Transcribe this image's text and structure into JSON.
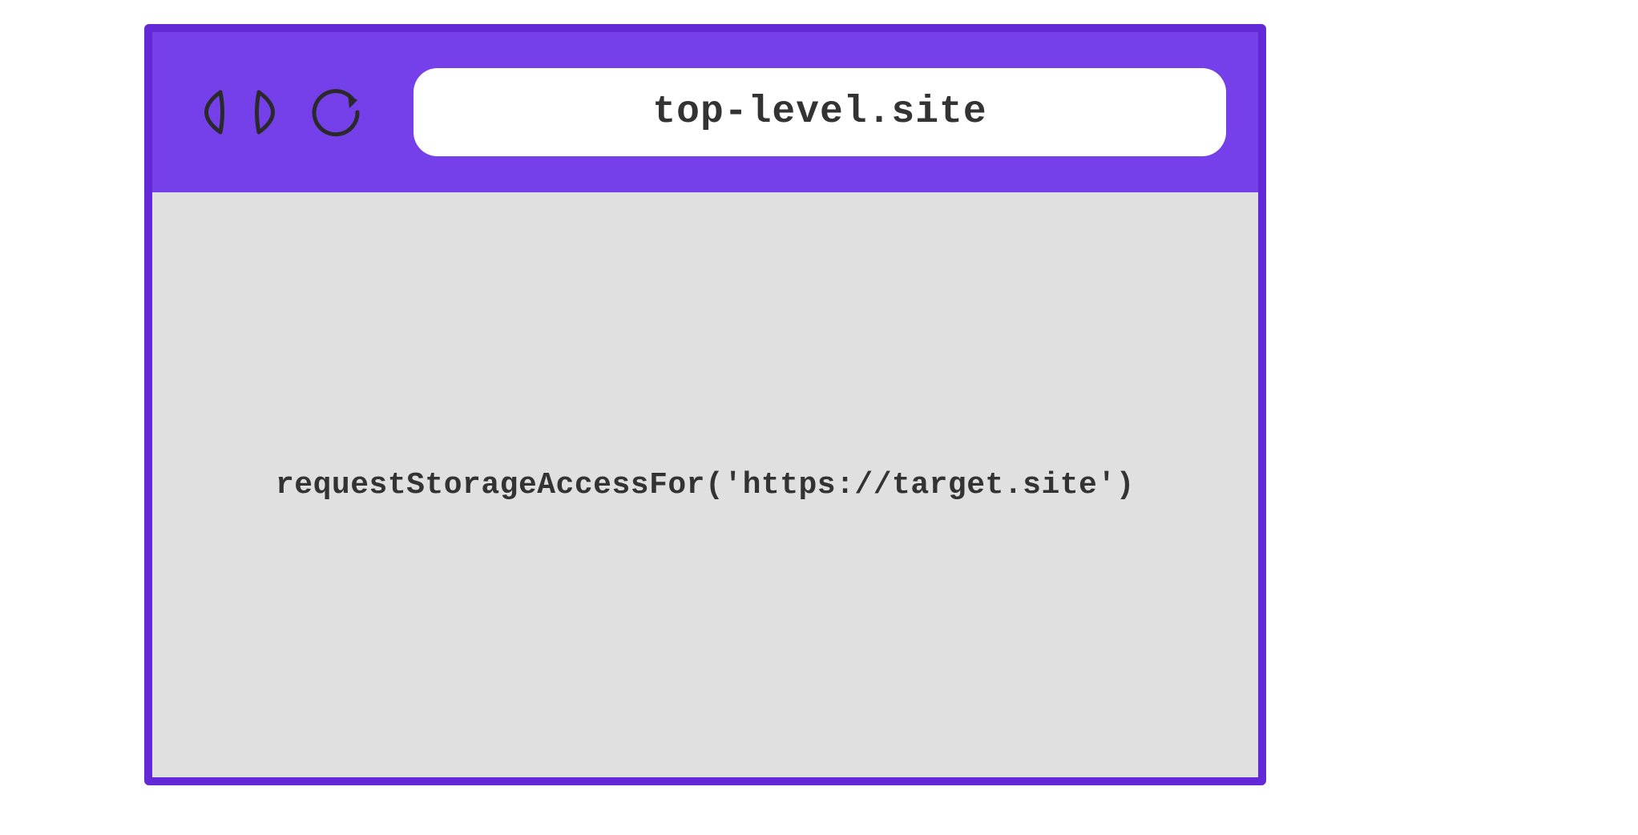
{
  "browser": {
    "address": "top-level.site",
    "content": {
      "code": "requestStorageAccessFor('https://target.site')"
    }
  },
  "colors": {
    "chrome_bg": "#7540ea",
    "border": "#6429d6",
    "content_bg": "#e0e0e0",
    "text": "#333333",
    "address_bg": "#ffffff"
  }
}
